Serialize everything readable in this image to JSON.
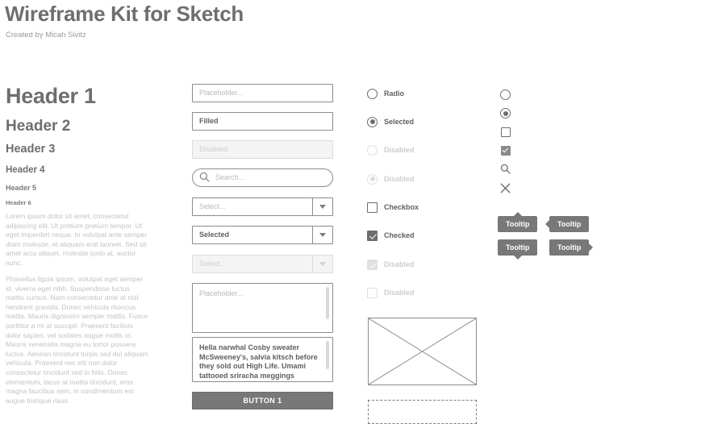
{
  "header": {
    "title": "Wireframe Kit for Sketch",
    "subtitle": "Created by Micah Sivitz"
  },
  "typography": {
    "headers": [
      {
        "label": "Header 1"
      },
      {
        "label": "Header 2"
      },
      {
        "label": "Header 3"
      },
      {
        "label": "Header 4"
      },
      {
        "label": "Header 5"
      },
      {
        "label": "Header 6"
      }
    ],
    "paragraphs": [
      "Lorem ipsum dolor sit amet, consectetur adipiscing elit. Ut pretium pretium tempor. Ut eget imperdiet neque. In volutpat ante semper diam molestie, et aliquam erat laoreet. Sed sit amet arcu aliquet, molestie justo at, auctor nunc.",
      "Phasellus ligula ipsum, volutpat eget semper id, viverra eget nibh. Suspendisse luctus mattis cursus. Nam consectetur ante at nisl hendrerit gravida. Donec vehicula rhoncus mattis. Mauris dignissim semper mattis. Fusce porttitor a mi at suscipit. Praesent facilisis dolor sapien, vel sodales augue mollis ut. Mauris venenatis magna eu tortor posuere luctus. Aenean tincidunt turpis sed dui aliquam vehicula. Praesent nec elit non dolor consectetur tincidunt sed in felis. Donec elementum, lacus at mattis tincidunt, eros magna faucibus sem, in condimentum est augue tristique risus."
    ]
  },
  "forms": {
    "inputs": [
      {
        "name": "placeholder",
        "value": "Placeholder...",
        "state": "placeholder"
      },
      {
        "name": "filled",
        "value": "Filled",
        "state": "filled"
      },
      {
        "name": "disabled",
        "value": "Disabled",
        "state": "disabled"
      },
      {
        "name": "search",
        "value": "Search...",
        "state": "placeholder",
        "icon": "search-icon"
      }
    ],
    "selects": [
      {
        "name": "empty",
        "value": "Select...",
        "state": "placeholder"
      },
      {
        "name": "selected",
        "value": "Selected",
        "state": "filled"
      },
      {
        "name": "disabled",
        "value": "Select...",
        "state": "disabled"
      }
    ],
    "textareas": [
      {
        "name": "placeholder",
        "value": "Placeholder...",
        "state": "placeholder"
      },
      {
        "name": "filled",
        "value": "Hella narwhal Cosby sweater McSweeney's, salvia kitsch before they sold out High Life. Umami tattooed sriracha meggings",
        "state": "filled"
      }
    ],
    "button": {
      "label": "BUTTON 1"
    }
  },
  "controls": {
    "radios": [
      {
        "label": "Radio",
        "checked": false,
        "disabled": false
      },
      {
        "label": "Selected",
        "checked": true,
        "disabled": false
      },
      {
        "label": "Disabled",
        "checked": false,
        "disabled": true
      },
      {
        "label": "Disabled",
        "checked": true,
        "disabled": true
      }
    ],
    "checkboxes": [
      {
        "label": "Checkbox",
        "checked": false,
        "disabled": false
      },
      {
        "label": "Checked",
        "checked": true,
        "disabled": false
      },
      {
        "label": "Disabled",
        "checked": true,
        "disabled": true
      },
      {
        "label": "Disabled",
        "checked": false,
        "disabled": true
      }
    ]
  },
  "icons": [
    {
      "name": "circle-icon"
    },
    {
      "name": "radio-selected-icon"
    },
    {
      "name": "square-icon"
    },
    {
      "name": "checkbox-checked-icon"
    },
    {
      "name": "search-icon"
    },
    {
      "name": "close-icon"
    }
  ],
  "tooltips": [
    {
      "label": "Tooltip",
      "arrow": "up"
    },
    {
      "label": "Tooltip",
      "arrow": "left"
    },
    {
      "label": "Tooltip",
      "arrow": "down"
    },
    {
      "label": "Tooltip",
      "arrow": "right"
    }
  ],
  "media": {
    "image_placeholder": "image-placeholder",
    "dashed_box": "dashed-drop-area"
  },
  "colors": {
    "ink": "#6e6e6e",
    "border": "#8c8c8c",
    "muted": "#c3c3c3",
    "fill": "#787878",
    "background": "#ffffff"
  }
}
